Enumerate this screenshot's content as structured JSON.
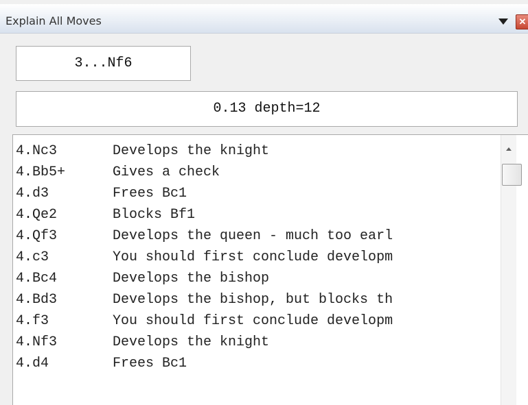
{
  "window": {
    "title": "Explain All Moves",
    "close_glyph": "✕",
    "icons": [
      "dropdown-menu-icon",
      "close-icon"
    ]
  },
  "current_move": "3...Nf6",
  "evaluation": "0.13 depth=12",
  "moves": [
    {
      "move": "4.Nc3",
      "explanation": "Develops the knight"
    },
    {
      "move": "4.Bb5+",
      "explanation": "Gives a check"
    },
    {
      "move": "4.d3",
      "explanation": "Frees Bc1"
    },
    {
      "move": "4.Qe2",
      "explanation": "Blocks Bf1"
    },
    {
      "move": "4.Qf3",
      "explanation": "Develops the queen - much too earl"
    },
    {
      "move": "4.c3",
      "explanation": "You should first conclude developm"
    },
    {
      "move": "4.Bc4",
      "explanation": "Develops the bishop"
    },
    {
      "move": "4.Bd3",
      "explanation": "Develops the bishop, but blocks th"
    },
    {
      "move": "4.f3",
      "explanation": "You should first conclude developm"
    },
    {
      "move": "4.Nf3",
      "explanation": "Develops the knight"
    },
    {
      "move": "4.d4",
      "explanation": "Frees Bc1"
    }
  ]
}
